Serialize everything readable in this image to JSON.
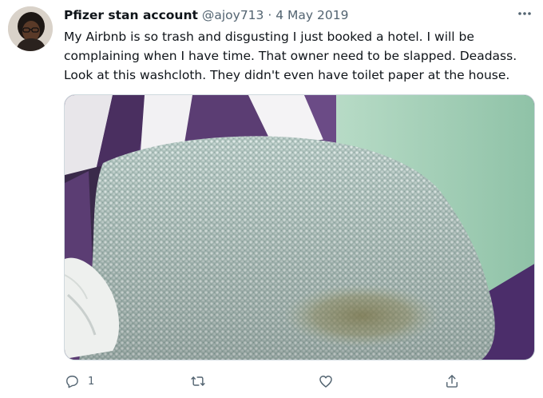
{
  "tweet": {
    "author_name": "Pfizer stan account",
    "handle": "@ajoy713",
    "separator": "·",
    "date": "4 May 2019",
    "text_lines": [
      "My Airbnb is so trash and disgusting I just booked a hotel.  I will be",
      "complaining when I have time. That owner need to be slapped. Deadass.",
      "Look at this washcloth. They didn't even have toilet paper at the house."
    ],
    "media": {
      "type": "photo"
    }
  },
  "actions": {
    "reply_count": "1",
    "icons": [
      "reply-icon",
      "retweet-icon",
      "like-icon",
      "share-icon"
    ]
  },
  "colors": {
    "secondary_text": "#536471",
    "primary_text": "#0f1419",
    "border": "#cfd9de"
  }
}
